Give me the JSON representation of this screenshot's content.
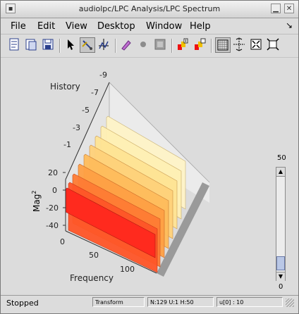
{
  "window": {
    "title": "audiolpc/LPC Analysis/LPC Spectrum"
  },
  "menubar": {
    "items": [
      {
        "label": "File"
      },
      {
        "label": "Edit"
      },
      {
        "label": "View"
      },
      {
        "label": "Desktop"
      },
      {
        "label": "Window"
      },
      {
        "label": "Help"
      }
    ]
  },
  "toolbar": {
    "tools": [
      "new-figure-icon",
      "open-icon",
      "save-icon",
      "select-arrow-icon",
      "edit-plot-icon",
      "data-cursor-icon",
      "brush-icon",
      "record-dot-icon",
      "fill-icon",
      "insert-colorbar-icon",
      "insert-legend-icon",
      "grid-icon",
      "axes-limits-icon",
      "zoom-fit-icon",
      "pan-icon"
    ]
  },
  "plot": {
    "ylabel": "Mag",
    "ylabel_exp": "2",
    "y_ticks": [
      "20",
      "0",
      "-20",
      "-40"
    ],
    "xlabel": "Frequency",
    "x_ticks": [
      "0",
      "50",
      "100"
    ],
    "history_label": "History",
    "history_ticks": [
      "-9",
      "-7",
      "-5",
      "-3",
      "-1"
    ]
  },
  "slider": {
    "max_label": "50",
    "min_label": "0"
  },
  "status": {
    "text": "Stopped",
    "cells": [
      "Transform",
      "N:129 U:1 H:50",
      "u[0] : 10"
    ]
  },
  "colors": {
    "trace_front": "#ff2a1e",
    "trace_back": "#fff4c8",
    "floor": "#9a9a9a"
  }
}
